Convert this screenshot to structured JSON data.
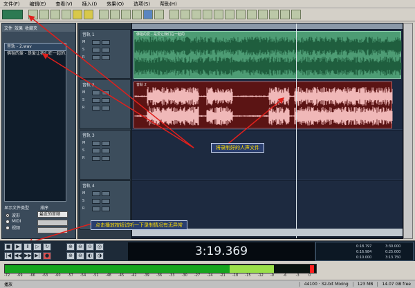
{
  "menu": [
    "文件(F)",
    "编辑(E)",
    "查看(V)",
    "插入(I)",
    "效果(O)",
    "选项(S)",
    "帮助(H)"
  ],
  "organizer": {
    "tabs": [
      "文件",
      "效果",
      "收藏夹"
    ],
    "files": [
      {
        "name": "音轨 - 2.wav",
        "selected": true
      },
      {
        "name": "佛祖的爱 - 是爱让我们在一起的.wma",
        "selected": false
      }
    ],
    "show_label": "显示文件类型",
    "sort_label": "排序",
    "sort_value": "最近的音频",
    "radios": [
      {
        "label": "波形",
        "checked": true
      },
      {
        "label": "MIDI",
        "checked": false
      },
      {
        "label": "视频",
        "checked": false
      }
    ]
  },
  "tracks": [
    {
      "name": "音轨 1",
      "row_labels": [
        "M",
        "S",
        "R"
      ]
    },
    {
      "name": "音轨 2",
      "row_labels": [
        "M",
        "S",
        "R"
      ]
    },
    {
      "name": "音轨 3",
      "row_labels": [
        "M",
        "S",
        "R"
      ]
    },
    {
      "name": "音轨 4",
      "row_labels": [
        "M",
        "S",
        "R"
      ]
    }
  ],
  "clips": {
    "green_title": "佛祖的爱 - 是爱让我们在一起的",
    "red_title": "音轨 2"
  },
  "callouts": {
    "recorded_file": "将录制好的人声文件",
    "play_hint": "点击播放按钮试听一下录制情况有无异常"
  },
  "time_display": "3:19.369",
  "info_values": {
    "begin": "0:18.797",
    "end": "0:16.984",
    "length": "0:10.000",
    "view_begin": "3:30.000",
    "view_end": "0:25.000",
    "view_length": "3:13.750"
  },
  "meter": {
    "level": 0.86,
    "hot_start": 0.72,
    "scale": [
      "-72",
      "-69",
      "-66",
      "-63",
      "-60",
      "-57",
      "-54",
      "-51",
      "-48",
      "-45",
      "-42",
      "-39",
      "-36",
      "-33",
      "-30",
      "-27",
      "-24",
      "-21",
      "-18",
      "-15",
      "-12",
      "-9",
      "-6",
      "-3",
      "0"
    ]
  },
  "status": {
    "left": "播放",
    "format": "44100 · 32-bit Mixing",
    "mem": "123 MB",
    "free": "14.07 GB free"
  },
  "colors": {
    "green_clip": "#4d9c74",
    "red_clip": "#5b1414",
    "callout_text": "#ffdd00"
  }
}
